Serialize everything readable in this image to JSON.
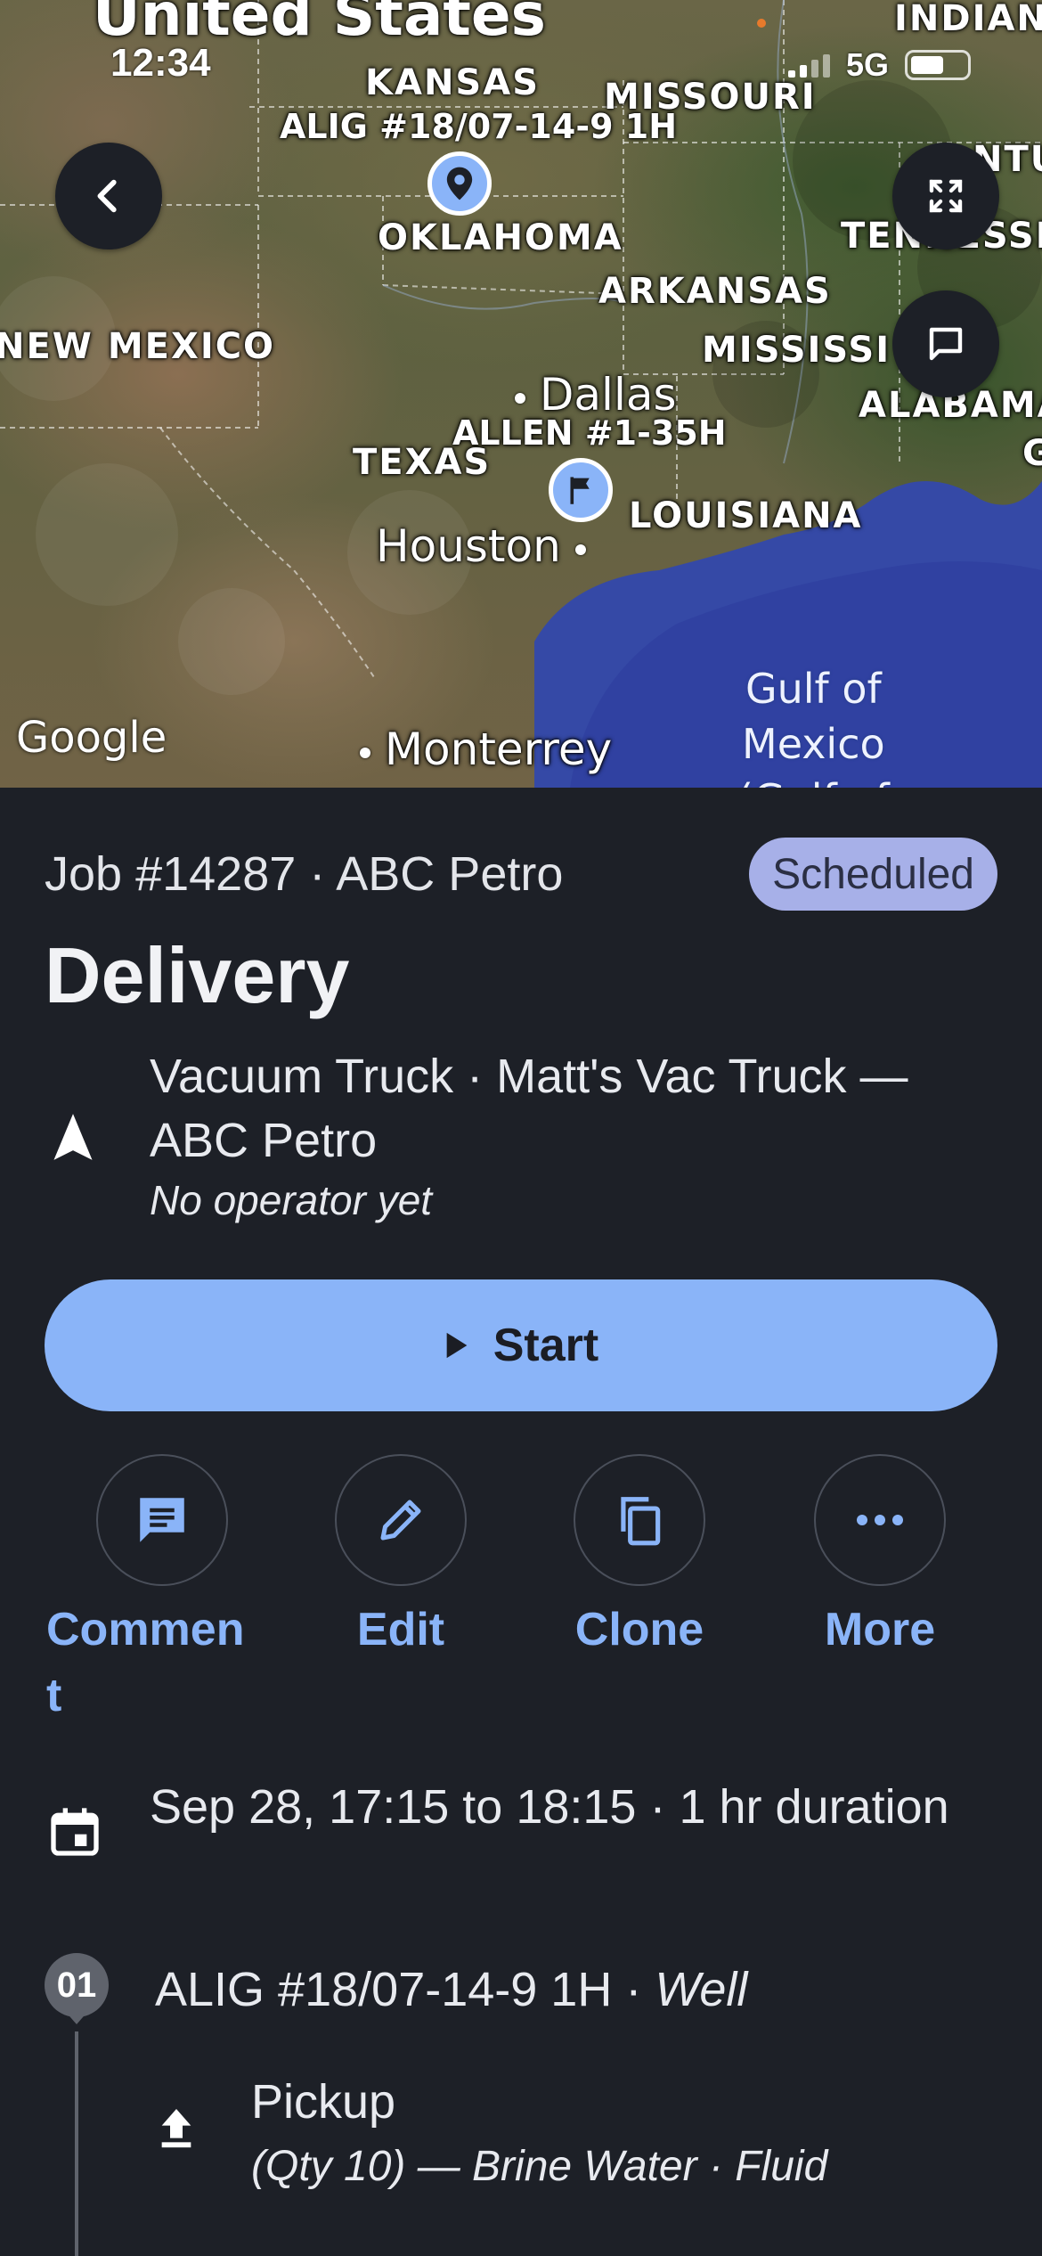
{
  "status_bar": {
    "time": "12:34",
    "network": "5G",
    "battery_level": 0.6
  },
  "map": {
    "country_label": "United States",
    "state_labels": [
      "KANSAS",
      "MISSOURI",
      "OKLAHOMA",
      "ARKANSAS",
      "NEW MEXICO",
      "MISSISSI",
      "TEXAS",
      "LOUISIANA",
      "ALABAMA",
      "TENNESSE",
      "INDIAN",
      "NTU",
      "G"
    ],
    "city_labels": [
      "Dallas",
      "Houston",
      "Monterrey"
    ],
    "sea_label": [
      "Gulf of",
      "Mexico",
      "(Gulf of"
    ],
    "markers": [
      {
        "label": "ALIG #18/07-14-9 1H",
        "icon": "location-pin-icon"
      },
      {
        "label": "ALLEN #1-35H",
        "icon": "flag-icon"
      }
    ],
    "attribution": "Google"
  },
  "job": {
    "header": "Job #14287 · ABC Petro",
    "status": "Scheduled",
    "status_color": "#a7b0e8",
    "title": "Delivery",
    "asset": "Vacuum Truck · Matt's Vac Truck — ABC Petro",
    "operator": "No operator yet",
    "start_label": "Start",
    "accent": "#8ab4f8"
  },
  "actions": [
    {
      "label": "Commen\nt",
      "icon": "comment-icon"
    },
    {
      "label": "Edit",
      "icon": "pencil-icon"
    },
    {
      "label": "Clone",
      "icon": "copy-icon"
    },
    {
      "label": "More",
      "icon": "more-dots-icon"
    }
  ],
  "schedule": {
    "text": "Sep 28, 17:15 to 18:15 · 1 hr duration"
  },
  "stops": [
    {
      "number": "01",
      "name": "ALIG #18/07-14-9 1H",
      "type": "Well",
      "task": "Pickup",
      "detail": "(Qty 10) — Brine Water · Fluid"
    }
  ]
}
